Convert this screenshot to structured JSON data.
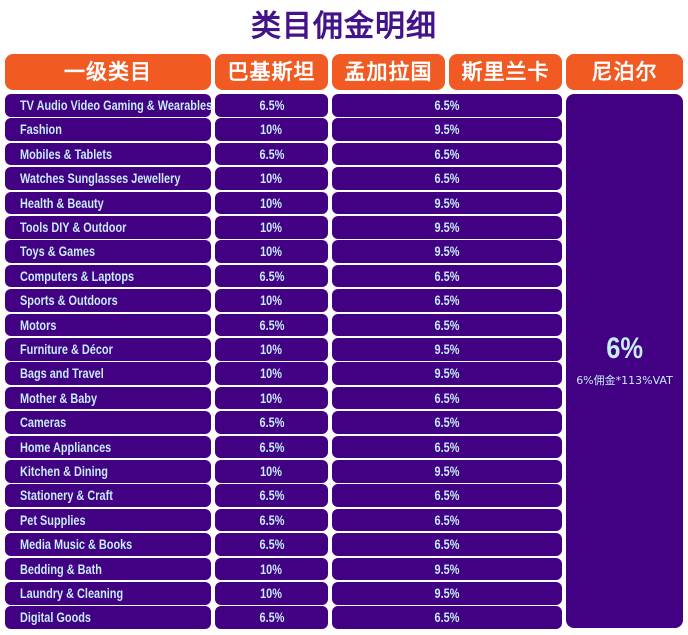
{
  "title": "类目佣金明细",
  "headers": {
    "category": "一级类目",
    "pakistan": "巴基斯坦",
    "bangladesh": "孟加拉国",
    "sri_lanka": "斯里兰卡",
    "nepal": "尼泊尔"
  },
  "nepal": {
    "rate": "6%",
    "note": "6%佣金*113%VAT"
  },
  "rows": [
    {
      "category": "TV Audio Video Gaming & Wearables",
      "pakistan": "6.5%",
      "bd_lk": "6.5%"
    },
    {
      "category": "Fashion",
      "pakistan": "10%",
      "bd_lk": "9.5%"
    },
    {
      "category": "Mobiles & Tablets",
      "pakistan": "6.5%",
      "bd_lk": "6.5%"
    },
    {
      "category": "Watches Sunglasses Jewellery",
      "pakistan": "10%",
      "bd_lk": "6.5%"
    },
    {
      "category": "Health & Beauty",
      "pakistan": "10%",
      "bd_lk": "9.5%"
    },
    {
      "category": "Tools DIY & Outdoor",
      "pakistan": "10%",
      "bd_lk": "9.5%"
    },
    {
      "category": "Toys & Games",
      "pakistan": "10%",
      "bd_lk": "9.5%"
    },
    {
      "category": "Computers & Laptops",
      "pakistan": "6.5%",
      "bd_lk": "6.5%"
    },
    {
      "category": "Sports & Outdoors",
      "pakistan": "10%",
      "bd_lk": "6.5%"
    },
    {
      "category": "Motors",
      "pakistan": "6.5%",
      "bd_lk": "6.5%"
    },
    {
      "category": "Furniture & Décor",
      "pakistan": "10%",
      "bd_lk": "9.5%"
    },
    {
      "category": "Bags and Travel",
      "pakistan": "10%",
      "bd_lk": "9.5%"
    },
    {
      "category": "Mother & Baby",
      "pakistan": "10%",
      "bd_lk": "6.5%"
    },
    {
      "category": "Cameras",
      "pakistan": "6.5%",
      "bd_lk": "6.5%"
    },
    {
      "category": "Home Appliances",
      "pakistan": "6.5%",
      "bd_lk": "6.5%"
    },
    {
      "category": "Kitchen & Dining",
      "pakistan": "10%",
      "bd_lk": "9.5%"
    },
    {
      "category": "Stationery & Craft",
      "pakistan": "6.5%",
      "bd_lk": "6.5%"
    },
    {
      "category": "Pet Supplies",
      "pakistan": "6.5%",
      "bd_lk": "6.5%"
    },
    {
      "category": "Media Music & Books",
      "pakistan": "6.5%",
      "bd_lk": "6.5%"
    },
    {
      "category": "Bedding & Bath",
      "pakistan": "10%",
      "bd_lk": "9.5%"
    },
    {
      "category": "Laundry & Cleaning",
      "pakistan": "10%",
      "bd_lk": "9.5%"
    },
    {
      "category": "Digital Goods",
      "pakistan": "6.5%",
      "bd_lk": "6.5%"
    }
  ]
}
